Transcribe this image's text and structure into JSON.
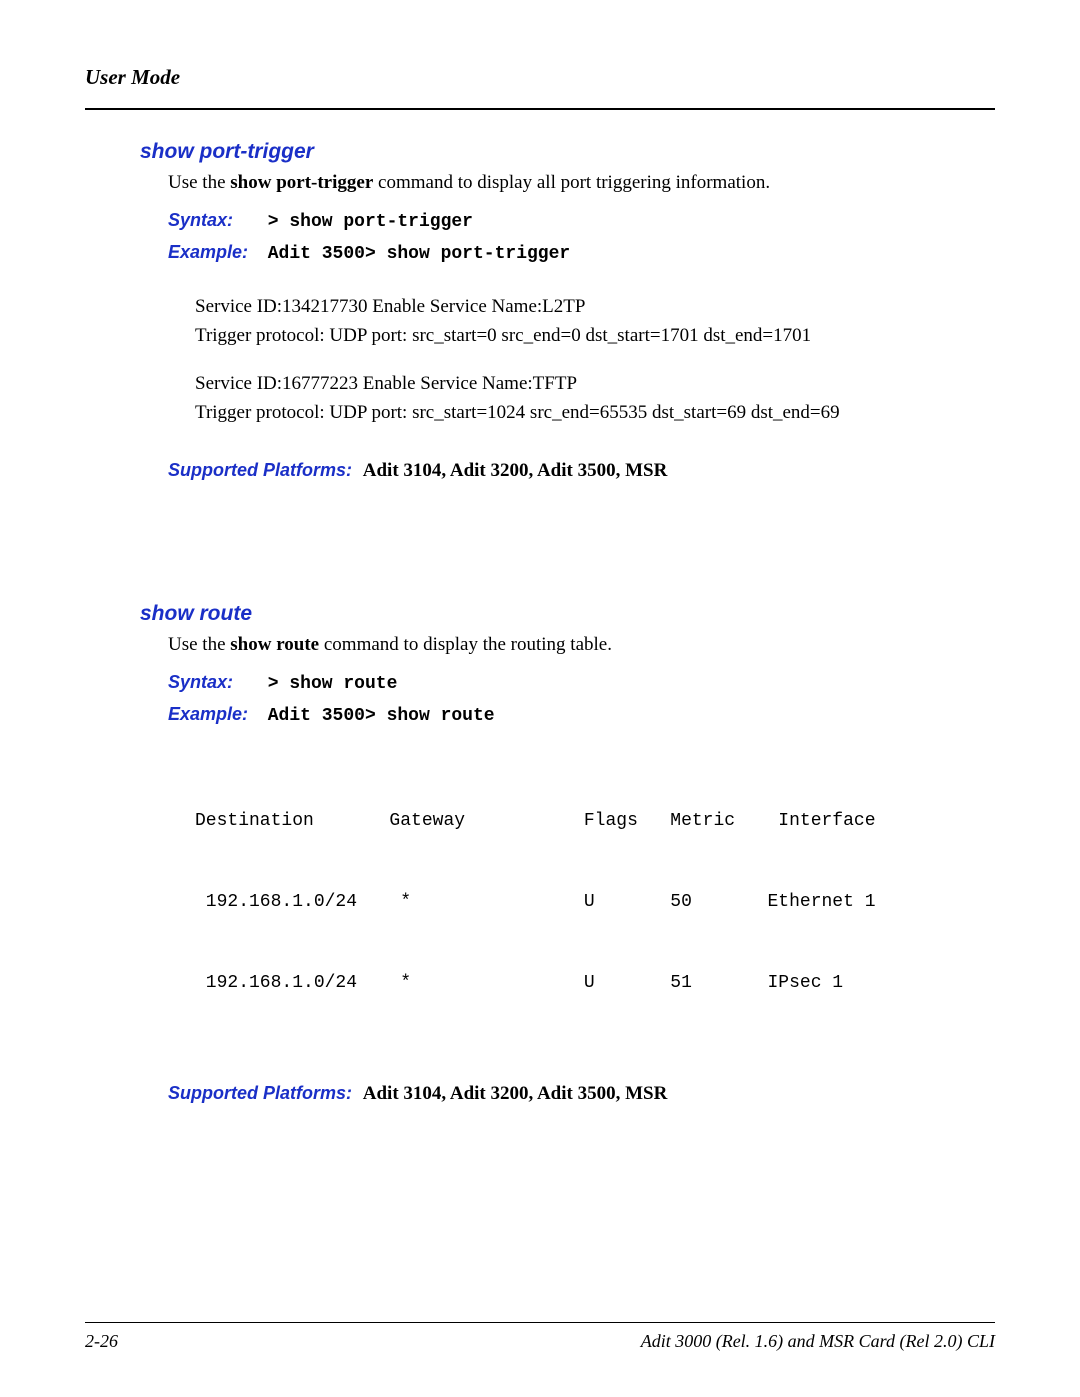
{
  "header": {
    "title": "User Mode"
  },
  "section1": {
    "heading": "show port-trigger",
    "intro_prefix": "Use the ",
    "intro_bold": "show port-trigger",
    "intro_suffix": " command to display all port triggering information.",
    "syntax_label": "Syntax:",
    "syntax_value": "> show port-trigger",
    "example_label": "Example:",
    "example_value": "Adit 3500> show port-trigger",
    "out_l1": "Service ID:134217730    Enable     Service Name:L2TP",
    "out_l2": "Trigger protocol: UDP   port: src_start=0       src_end=0        dst_start=1701     dst_end=1701",
    "out_l3": "Service ID:16777223     Enable     Service Name:TFTP",
    "out_l4": "Trigger protocol: UDP   port: src_start=1024    src_end=65535   dst_start=69    dst_end=69",
    "supported_label": "Supported Platforms:",
    "supported_value": "Adit 3104, Adit 3200, Adit 3500, MSR"
  },
  "section2": {
    "heading": "show route",
    "intro_prefix": "Use the ",
    "intro_bold": "show route",
    "intro_suffix": " command to display the routing table.",
    "syntax_label": "Syntax:",
    "syntax_value": "> show route",
    "example_label": "Example:",
    "example_value": "Adit 3500> show route",
    "route_header": "Destination       Gateway           Flags   Metric    Interface",
    "route_r1": " 192.168.1.0/24    *                U       50       Ethernet 1",
    "route_r2": " 192.168.1.0/24    *                U       51       IPsec 1",
    "supported_label": "Supported Platforms:",
    "supported_value": "Adit 3104, Adit 3200, Adit 3500, MSR"
  },
  "footer": {
    "page_number": "2-26",
    "manual_title": "Adit 3000 (Rel. 1.6) and MSR Card (Rel 2.0) CLI"
  },
  "chart_data": {
    "type": "table",
    "title": "Routing Table",
    "columns": [
      "Destination",
      "Gateway",
      "Flags",
      "Metric",
      "Interface"
    ],
    "rows": [
      [
        "192.168.1.0/24",
        "*",
        "U",
        50,
        "Ethernet 1"
      ],
      [
        "192.168.1.0/24",
        "*",
        "U",
        51,
        "IPsec 1"
      ]
    ]
  }
}
